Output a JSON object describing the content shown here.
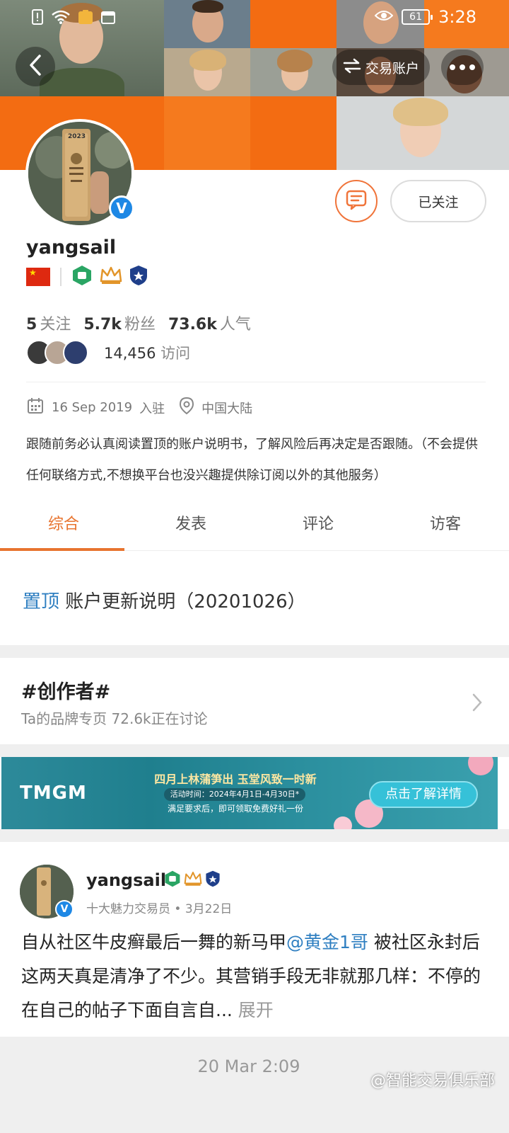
{
  "status_bar": {
    "battery": "61",
    "time": "3:28"
  },
  "header": {
    "trade_label": "交易账户"
  },
  "profile": {
    "username": "yangsail",
    "following_count": "5",
    "following_label": "关注",
    "followers_count": "5.7k",
    "followers_label": "粉丝",
    "popularity_count": "73.6k",
    "popularity_label": "人气",
    "visits_count": "14,456",
    "visits_label": "访问",
    "joined_date": "16 Sep 2019",
    "joined_label": "入驻",
    "location": "中国大陆",
    "bio": "跟随前务必认真阅读置顶的账户说明书，了解风险后再决定是否跟随。（不会提供任何联络方式,不想换平台也没兴趣提供除订阅以外的其他服务）",
    "follow_button": "已关注",
    "avatar_plaque_year": "2023"
  },
  "tabs": [
    {
      "label": "综合",
      "active": true
    },
    {
      "label": "发表",
      "active": false
    },
    {
      "label": "评论",
      "active": false
    },
    {
      "label": "访客",
      "active": false
    }
  ],
  "pinned": {
    "tag": "置顶",
    "title": "账户更新说明（20201026）"
  },
  "creator": {
    "title": "#创作者#",
    "subtitle": "Ta的品牌专页  72.6k正在讨论"
  },
  "banner": {
    "brand": "TMGM",
    "headline": "四月上林蒲笋出  玉堂风致一时新",
    "date": "活动时间：2024年4月1日-4月30日*",
    "gift_line": "满足要求后，即可领取免费好礼一份",
    "cta": "点击了解详情"
  },
  "post": {
    "username": "yangsail",
    "meta": "十大魅力交易员 • 3月22日",
    "body_before": "自从社区牛皮癣最后一舞的新马甲",
    "mention": "@黄金1哥",
    "body_after": " 被社区永封后这两天真是清净了不少。其营销手段无非就那几样：不停的在自己的帖子下面自言自...",
    "expand": "展开"
  },
  "footer": {
    "timestamp": "20 Mar 2:09",
    "watermark": "@智能交易俱乐部"
  },
  "colors": {
    "accent": "#e8742f",
    "link": "#2f7fc1",
    "cover_orange": "#f36c12",
    "verify_blue": "#1e88e5"
  }
}
